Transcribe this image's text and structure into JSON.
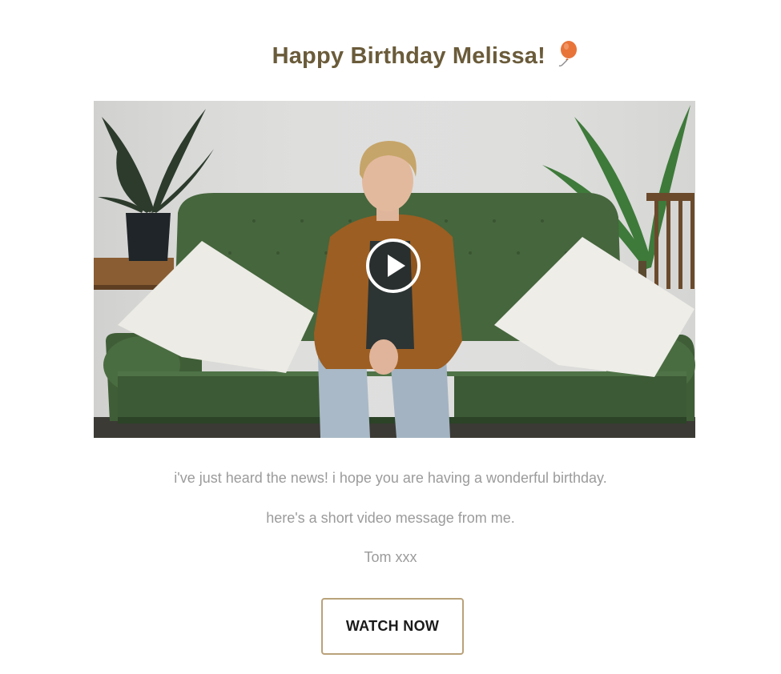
{
  "header": {
    "title": "Happy Birthday  Melissa!",
    "icon": "balloon-icon",
    "icon_color": "#e8743a"
  },
  "video": {
    "play_icon": "play-icon"
  },
  "message": {
    "line1": "i've just heard the news! i hope you are having a wonderful birthday.",
    "line2": "here's a short video message from me.",
    "signature": "Tom xxx"
  },
  "cta": {
    "label": "WATCH NOW",
    "border_color": "#b9a27a"
  }
}
